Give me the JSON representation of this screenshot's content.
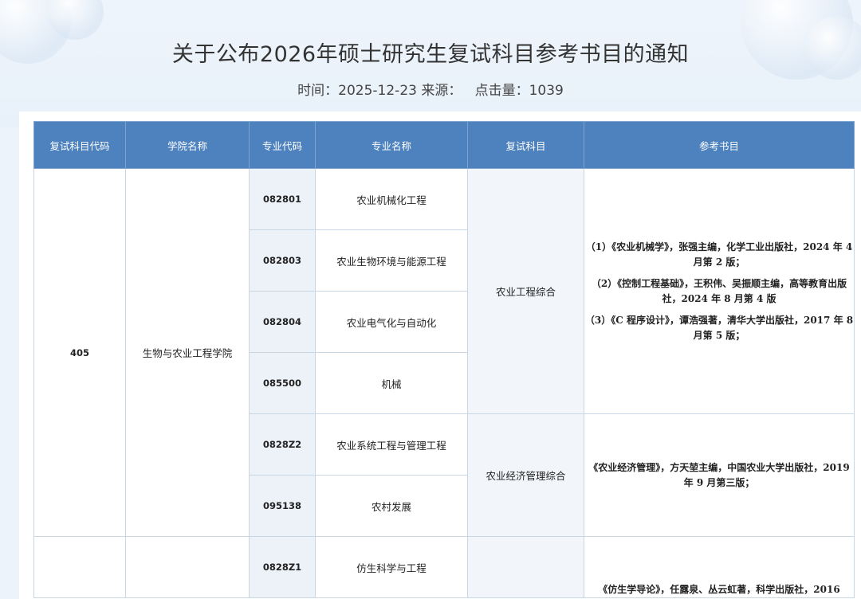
{
  "notice": {
    "title": "关于公布2026年硕士研究生复试科目参考书目的通知",
    "time_label": "时间：",
    "time_value": "2025-12-23",
    "source_label": "来源：",
    "source_value": "",
    "clicks_label": "点击量：",
    "clicks_value": "1039"
  },
  "table": {
    "headers": [
      "复试科目代码",
      "学院名称",
      "专业代码",
      "专业名称",
      "复试科目",
      "参考书目"
    ],
    "groups": [
      {
        "subject_code": "405",
        "college": "生物与农业工程学院",
        "subjects": [
          {
            "name": "农业工程综合",
            "books": [
              "（1）《农业机械学》，张强主编，化学工业出版社，2024 年 4 月第 2 版；",
              "（2）《控制工程基础》，王积伟、吴振顺主编，高等教育出版社，2024 年 8 月第 4 版",
              "（3）《C 程序设计》，谭浩强著，清华大学出版社，2017 年 8 月第 5 版；"
            ],
            "majors": [
              {
                "code": "082801",
                "name": "农业机械化工程"
              },
              {
                "code": "082803",
                "name": "农业生物环境与能源工程"
              },
              {
                "code": "082804",
                "name": "农业电气化与自动化"
              },
              {
                "code": "085500",
                "name": "机械"
              }
            ]
          },
          {
            "name": "农业经济管理综合",
            "books": [
              "《农业经济管理》，方天堃主编，中国农业大学出版社，2019 年 9 月第三版；"
            ],
            "majors": [
              {
                "code": "0828Z2",
                "name": "农业系统工程与管理工程"
              },
              {
                "code": "095138",
                "name": "农村发展"
              }
            ]
          }
        ]
      },
      {
        "subject_code": "",
        "college": "",
        "subjects": [
          {
            "name": "",
            "books": [
              "《仿生学导论》，任露泉、丛云虹著，科学出版社，2016"
            ],
            "majors": [
              {
                "code": "0828Z1",
                "name": "仿生科学与工程"
              }
            ]
          }
        ]
      }
    ]
  }
}
